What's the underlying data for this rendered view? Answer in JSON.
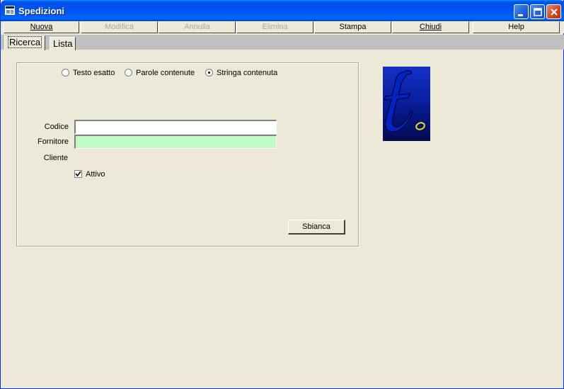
{
  "window": {
    "title": "Spedizioni"
  },
  "menu": {
    "nuova": "Nuova",
    "modifica": "Modifica",
    "annulla": "Annulla",
    "elimina": "Elimina",
    "stampa": "Stampa",
    "chiudi": "Chiudi",
    "help": "Help"
  },
  "tabs": {
    "ricerca": "Ricerca",
    "lista": "Lista"
  },
  "search_mode": {
    "options": [
      "Testo esatto",
      "Parole contenute",
      "Stringa contenuta"
    ],
    "selected": "Stringa contenuta"
  },
  "form": {
    "codice_label": "Codice",
    "codice_value": "",
    "fornitore_label": "Fornitore",
    "fornitore_value": "",
    "fornitore_bg": "#c0fcc4",
    "cliente_label": "Cliente",
    "attivo_label": "Attivo",
    "attivo_checked": true,
    "sbianca_label": "Sbianca"
  },
  "icons": {
    "app": "app-window-icon",
    "minimize": "minimize-icon",
    "maximize": "maximize-icon",
    "close": "close-icon",
    "logo": "logo-t-icon"
  }
}
